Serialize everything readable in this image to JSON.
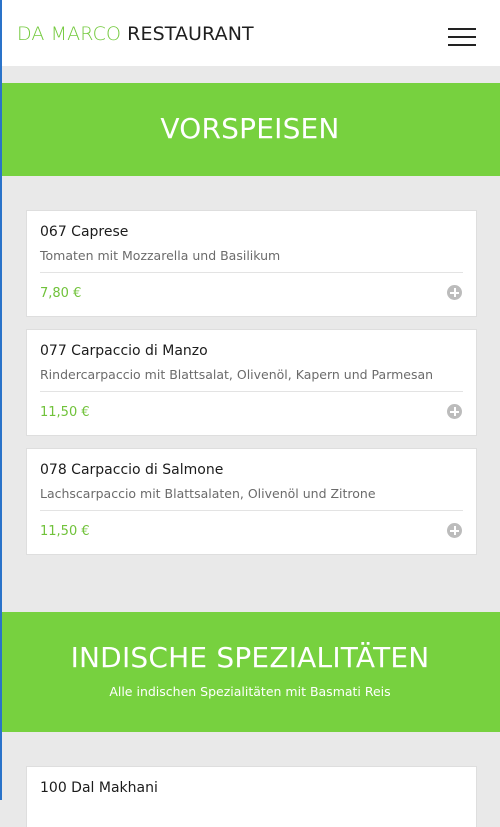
{
  "header": {
    "brand_first": "DA MARCO",
    "brand_second": "RESTAURANT",
    "menu_icon": "hamburger-menu-icon"
  },
  "sections": [
    {
      "title": "VORSPEISEN",
      "subtitle": "",
      "items": [
        {
          "name": "067 Caprese",
          "description": "Tomaten mit Mozzarella und Basilikum",
          "price": "7,80 €",
          "action_icon": "plus-circle-icon"
        },
        {
          "name": "077 Carpaccio di Manzo",
          "description": "Rindercarpaccio mit Blattsalat, Olivenöl, Kapern und Parmesan",
          "price": "11,50 €",
          "action_icon": "plus-circle-icon"
        },
        {
          "name": "078 Carpaccio di Salmone",
          "description": "Lachscarpaccio mit Blattsalaten, Olivenöl und Zitrone",
          "price": "11,50 €",
          "action_icon": "plus-circle-icon"
        }
      ]
    },
    {
      "title": "INDISCHE SPEZIALITÄTEN",
      "subtitle": "Alle indischen Spezialitäten mit Basmati Reis",
      "items": [
        {
          "name": "100 Dal Makhani"
        }
      ]
    }
  ],
  "colors": {
    "accent": "#77d13f",
    "price": "#70c23a",
    "background": "#e9e9e9",
    "card": "#ffffff",
    "text": "#1c1c1c",
    "muted": "#6b6b6b"
  }
}
